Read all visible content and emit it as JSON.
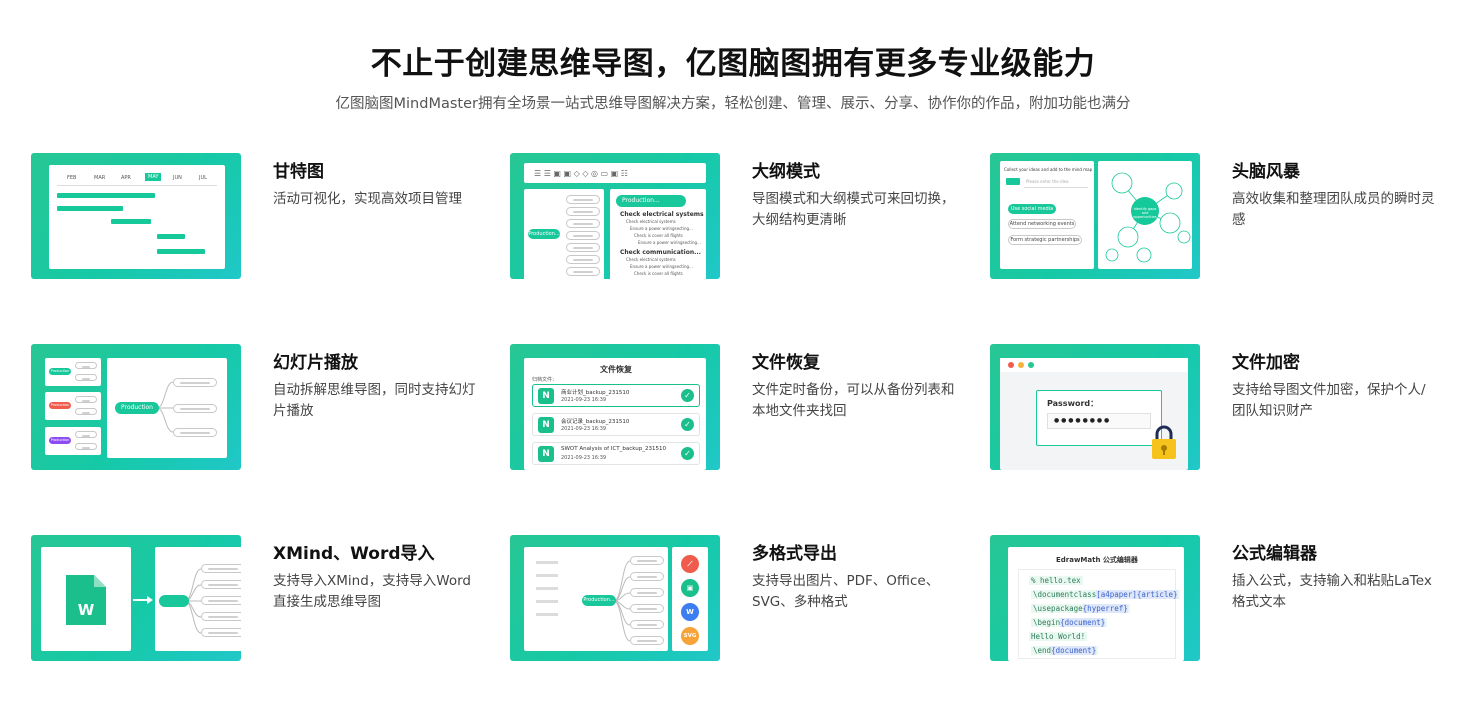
{
  "header": {
    "title": "不止于创建思维导图，亿图脑图拥有更多专业级能力",
    "subtitle": "亿图脑图MindMaster拥有全场景一站式思维导图解决方案，轻松创建、管理、展示、分享、协作你的作品，附加功能也满分"
  },
  "features": [
    {
      "title": "甘特图",
      "desc": "活动可视化，实现高效项目管理"
    },
    {
      "title": "大纲模式",
      "desc": "导图模式和大纲模式可来回切换，大纲结构更清晰"
    },
    {
      "title": "头脑风暴",
      "desc": "高效收集和整理团队成员的瞬时灵感"
    },
    {
      "title": "幻灯片播放",
      "desc": "自动拆解思维导图，同时支持幻灯片播放"
    },
    {
      "title": "文件恢复",
      "desc": "文件定时备份，可以从备份列表和本地文件夹找回"
    },
    {
      "title": "文件加密",
      "desc": "支持给导图文件加密，保护个人/团队知识财产"
    },
    {
      "title": "XMind、Word导入",
      "desc": "支持导入XMind，支持导入Word直接生成思维导图"
    },
    {
      "title": "多格式导出",
      "desc": "支持导出图片、PDF、Office、SVG、多种格式"
    },
    {
      "title": "公式编辑器",
      "desc": "插入公式，支持输入和粘贴LaTex格式文本"
    }
  ],
  "gantt": {
    "months": [
      "FEB",
      "MAR",
      "APR",
      "MAY",
      "JUN",
      "JUL"
    ]
  },
  "outline": {
    "root": "Production...",
    "items": [
      "Check electrical systems",
      "Check communication..."
    ],
    "sub": [
      "Check electrical systems",
      "Ensure a power wiringsecting...",
      "Check is cover all flights",
      "Ensure a power wiringsecting..."
    ]
  },
  "brainstorm": {
    "prompt": "Collect your ideas and add to the mind map",
    "input_placeholder": "Please enter the idea",
    "ideas": [
      "Use social media",
      "Attend networking events",
      "Form strategic partnerships"
    ],
    "center": "Identify gaps and opportunities"
  },
  "slides": {
    "center": "Production",
    "labels": [
      "Production",
      "Production",
      "Production"
    ]
  },
  "recovery": {
    "title": "文件恢复",
    "label": "归档文件：",
    "files": [
      {
        "name": "商业计划_backup_231510",
        "time": "2021-09-23 16:39"
      },
      {
        "name": "会议记录_backup_231510",
        "time": "2021-09-23 16:39"
      },
      {
        "name": "SWOT Analysis of ICT_backup_231510",
        "time": "2021-09-23 16:39"
      }
    ]
  },
  "encrypt": {
    "label": "Password：",
    "mask": "● ● ● ● ● ● ● ●"
  },
  "import": {
    "doc_letter": "W"
  },
  "export": {
    "root": "Production...",
    "formats": [
      "PDF",
      "IMG",
      "W",
      "SVG"
    ]
  },
  "formula": {
    "title": "EdrawMath 公式编辑器",
    "lines": [
      {
        "text": "% hello.tex",
        "hl": ""
      },
      {
        "text": "\\documentclass",
        "hl": "[a4paper]{article}"
      },
      {
        "text": "\\usepackage",
        "hl": "{hyperref}"
      },
      {
        "text": "\\begin",
        "hl": "{document}"
      },
      {
        "text": "Hello World!",
        "hl": ""
      },
      {
        "text": "\\end",
        "hl": "{document}"
      }
    ]
  },
  "colors": {
    "accent": "#16c99a",
    "pdf": "#ef5b4d",
    "img": "#1bbf8c",
    "word": "#3d7df2",
    "svg": "#f7a337"
  }
}
